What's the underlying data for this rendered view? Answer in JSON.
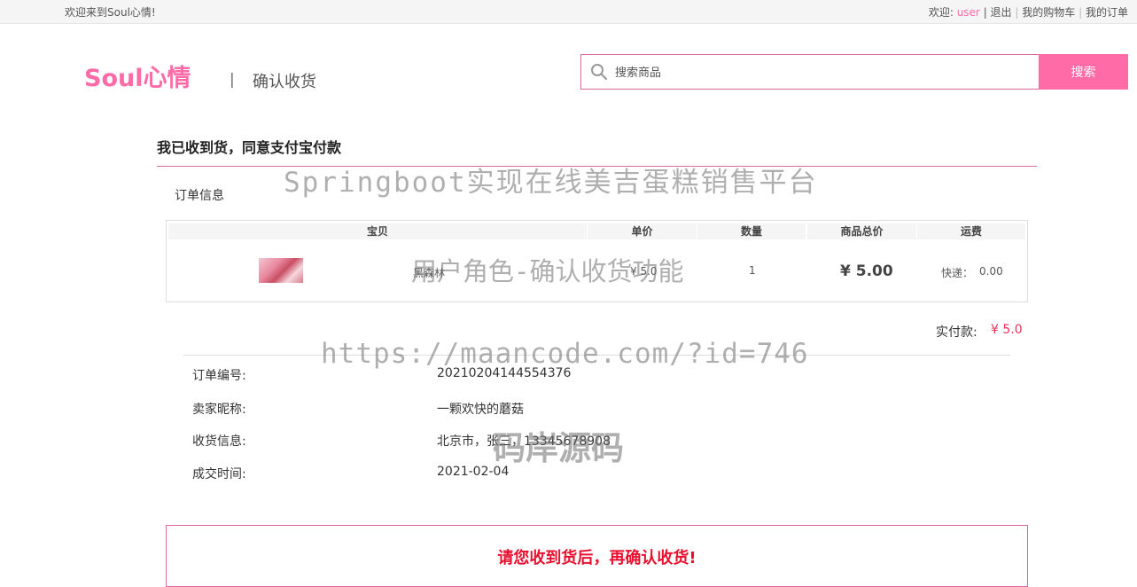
{
  "topbar": {
    "welcome": "欢迎来到Soul心情!",
    "greeting": "欢迎:",
    "username": "user",
    "logout": "| 退出",
    "cart": "我的购物车",
    "orders": "我的订单"
  },
  "header": {
    "logo": "Soul心情",
    "divider": "|",
    "page_subtitle": "确认收货"
  },
  "search": {
    "placeholder": "搜索商品",
    "button": "搜索"
  },
  "section": {
    "title": "我已收到货，同意支付宝付款",
    "order_info_label": "订单信息"
  },
  "table": {
    "headers": [
      "宝贝",
      "单价",
      "数量",
      "商品总价",
      "运费"
    ],
    "row": {
      "name": "黑森林",
      "price": "¥ 5.0",
      "quantity": "1",
      "total": "¥ 5.00",
      "shipping_label": "快递：",
      "shipping_value": "0.00"
    }
  },
  "payment": {
    "label": "实付款:",
    "value": "¥ 5.0"
  },
  "order_details": [
    {
      "label": "订单编号:",
      "value": "20210204144554376"
    },
    {
      "label": "卖家昵称:",
      "value": "一颗欢快的蘑菇"
    },
    {
      "label": "收货信息:",
      "value": "北京市，张三，13345678908"
    },
    {
      "label": "成交时间:",
      "value": "2021-02-04"
    }
  ],
  "confirm": {
    "message": "请您收到货后，再确认收货!"
  },
  "watermarks": {
    "line1": "Springboot实现在线美吉蛋糕销售平台",
    "line2": "用户角色-确认收货功能",
    "line3": "https://maancode.com/?id=746",
    "line4": "码岸源码"
  },
  "colors": {
    "accent": "#ff6ba6",
    "price_red": "#e8335a",
    "alert_red": "#e8102e"
  }
}
